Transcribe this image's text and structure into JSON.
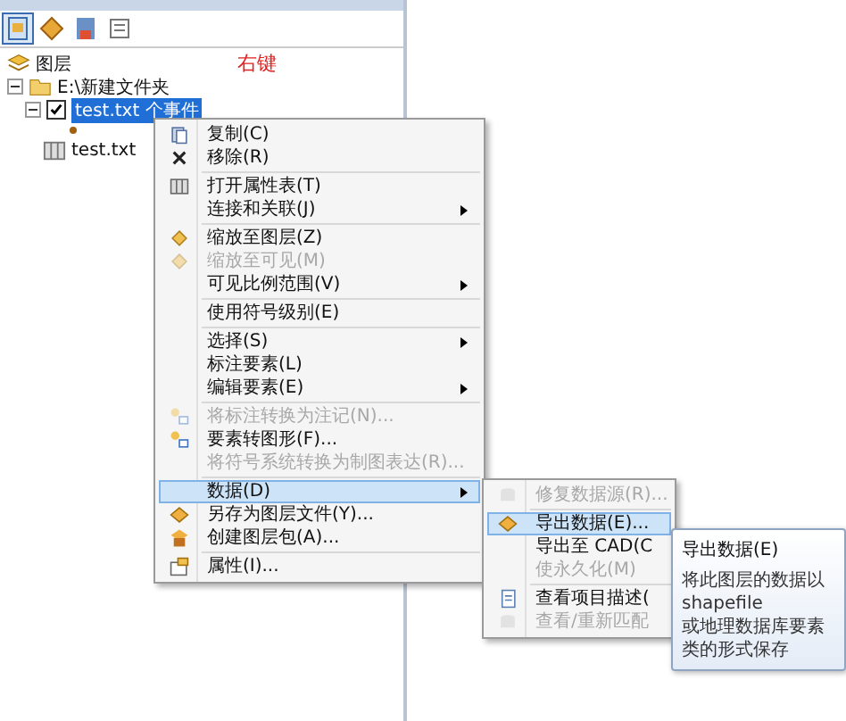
{
  "tree": [
    {
      "label": "图层",
      "children": [
        {
          "label": "E:\\新建文件夹",
          "expanded": true,
          "children": [
            {
              "label": "test.txt 个事件",
              "checked": true,
              "selected": true,
              "expanded": true
            },
            {
              "label": "test.txt",
              "selected": false
            }
          ]
        }
      ]
    }
  ],
  "annotation": "右键",
  "context_menu": [
    {
      "kind": "item",
      "label": "复制(C)",
      "disabled": false,
      "selected": false,
      "submenu": false
    },
    {
      "kind": "item",
      "label": "移除(R)",
      "disabled": false,
      "selected": false,
      "submenu": false
    },
    {
      "kind": "separator"
    },
    {
      "kind": "item",
      "label": "打开属性表(T)",
      "disabled": false,
      "selected": false,
      "submenu": false
    },
    {
      "kind": "item",
      "label": "连接和关联(J)",
      "disabled": false,
      "selected": false,
      "submenu": true
    },
    {
      "kind": "separator"
    },
    {
      "kind": "item",
      "label": "缩放至图层(Z)",
      "disabled": false,
      "selected": false,
      "submenu": false
    },
    {
      "kind": "item",
      "label": "缩放至可见(M)",
      "disabled": true,
      "selected": false,
      "submenu": false
    },
    {
      "kind": "item",
      "label": "可见比例范围(V)",
      "disabled": false,
      "selected": false,
      "submenu": true
    },
    {
      "kind": "separator"
    },
    {
      "kind": "item",
      "label": "使用符号级别(E)",
      "disabled": false,
      "selected": false,
      "submenu": false
    },
    {
      "kind": "separator"
    },
    {
      "kind": "item",
      "label": "选择(S)",
      "disabled": false,
      "selected": false,
      "submenu": true
    },
    {
      "kind": "item",
      "label": "标注要素(L)",
      "disabled": false,
      "selected": false,
      "submenu": false
    },
    {
      "kind": "item",
      "label": "编辑要素(E)",
      "disabled": false,
      "selected": false,
      "submenu": true
    },
    {
      "kind": "separator"
    },
    {
      "kind": "item",
      "label": "将标注转换为注记(N)...",
      "disabled": true,
      "selected": false,
      "submenu": false
    },
    {
      "kind": "item",
      "label": "要素转图形(F)...",
      "disabled": false,
      "selected": false,
      "submenu": false
    },
    {
      "kind": "item",
      "label": "将符号系统转换为制图表达(R)...",
      "disabled": true,
      "selected": false,
      "submenu": false
    },
    {
      "kind": "separator"
    },
    {
      "kind": "item",
      "label": "数据(D)",
      "disabled": false,
      "selected": true,
      "submenu": true
    },
    {
      "kind": "item",
      "label": "另存为图层文件(Y)...",
      "disabled": false,
      "selected": false,
      "submenu": false
    },
    {
      "kind": "item",
      "label": "创建图层包(A)...",
      "disabled": false,
      "selected": false,
      "submenu": false
    },
    {
      "kind": "separator"
    },
    {
      "kind": "item",
      "label": "属性(I)...",
      "disabled": false,
      "selected": false,
      "submenu": false
    }
  ],
  "submenu": [
    {
      "label": "修复数据源(R)...",
      "disabled": true,
      "selected": false
    },
    {
      "label": "导出数据(E)...",
      "disabled": false,
      "selected": true
    },
    {
      "label": "导出至 CAD(C",
      "disabled": false,
      "selected": false
    },
    {
      "label": "使永久化(M)",
      "disabled": true,
      "selected": false
    },
    {
      "label": "查看项目描述(",
      "disabled": false,
      "selected": false
    },
    {
      "label": "查看/重新匹配",
      "disabled": true,
      "selected": false
    }
  ],
  "tooltip": {
    "title": "导出数据(E)",
    "text": "将此图层的数据以 shapefile\n或地理数据库要素类的形式保存"
  }
}
